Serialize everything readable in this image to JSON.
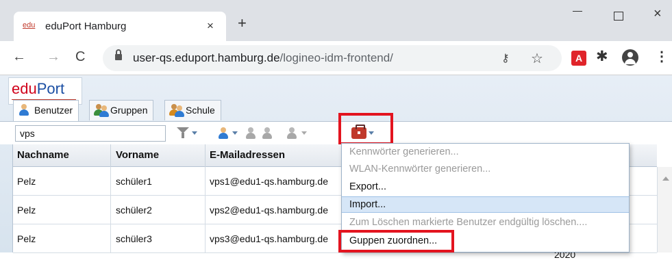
{
  "browser": {
    "tab_favicon_text": "edu",
    "tab_title": "eduPort Hamburg",
    "tab_close": "×",
    "new_tab": "+",
    "url_host": "user-qs.eduport.hamburg.de",
    "url_path": "/logineo-idm-frontend/",
    "back": "←",
    "forward": "→",
    "reload": "C",
    "close": "×",
    "kebab": "⋮",
    "pdf_ext": "A"
  },
  "app": {
    "logo_edu": "edu",
    "logo_port": "Port",
    "tabs": [
      {
        "label": "Benutzer",
        "active": true
      },
      {
        "label": "Gruppen",
        "active": false
      },
      {
        "label": "Schule",
        "active": false
      }
    ],
    "search_value": "vps"
  },
  "grid": {
    "columns": [
      "Nachname",
      "Vorname",
      "E-Mailadressen"
    ],
    "rows": [
      {
        "nachname": "Pelz",
        "vorname": "schüler1",
        "email": "vps1@edu1-qs.hamburg.de"
      },
      {
        "nachname": "Pelz",
        "vorname": "schüler2",
        "email": "vps2@edu1-qs.hamburg.de"
      },
      {
        "nachname": "Pelz",
        "vorname": "schüler3",
        "email": "vps3@edu1-qs.hamburg.de"
      }
    ],
    "partial_value": "2020"
  },
  "menu": {
    "items": [
      {
        "label": "Kennwörter generieren...",
        "state": "disabled"
      },
      {
        "label": "WLAN-Kennwörter generieren...",
        "state": "disabled"
      },
      {
        "label": "Export...",
        "state": "enabled"
      },
      {
        "label": "Import...",
        "state": "hover"
      },
      {
        "label": "Zum Löschen markierte Benutzer endgültig löschen....",
        "state": "disabled"
      },
      {
        "label": "Guppen zuordnen...",
        "state": "enabled"
      }
    ]
  },
  "colors": {
    "highlight_border": "#e3141f",
    "menu_hover": "#d6e6f7",
    "logo_red": "#d0021b",
    "logo_blue": "#1a4ea3"
  }
}
